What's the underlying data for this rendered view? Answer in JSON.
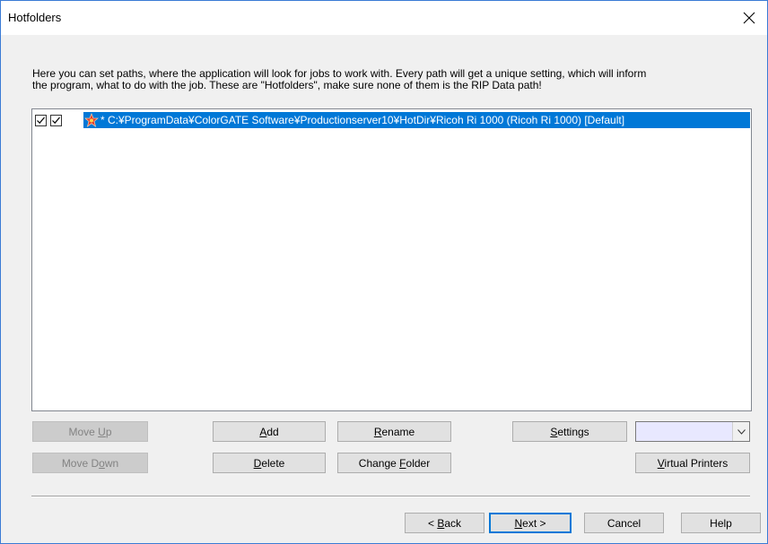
{
  "window": {
    "title": "Hotfolders",
    "close_icon": "close-icon"
  },
  "description": "Here you can set paths, where the application will look for jobs to work with. Every path will get a unique setting, which will inform\nthe program, what to do with the job. These are \"Hotfolders\", make sure none of them is the RIP Data path!",
  "hotfolders": [
    {
      "checked_1": true,
      "checked_2": true,
      "icon": "default-star-icon",
      "path": "* C:¥ProgramData¥ColorGATE Software¥Productionserver10¥HotDir¥Ricoh Ri 1000 (Ricoh Ri 1000) [Default]",
      "selected": true
    }
  ],
  "buttons": {
    "move_up": {
      "pre": "Move ",
      "key": "U",
      "post": "p"
    },
    "move_down": {
      "pre": "Move D",
      "key": "o",
      "post": "wn"
    },
    "add": {
      "pre": "",
      "key": "A",
      "post": "dd"
    },
    "delete": {
      "pre": "",
      "key": "D",
      "post": "elete"
    },
    "rename": {
      "pre": "",
      "key": "R",
      "post": "ename"
    },
    "change_folder": {
      "pre": "Change ",
      "key": "F",
      "post": "older"
    },
    "settings": {
      "pre": "",
      "key": "S",
      "post": "ettings"
    },
    "virtual_printers": {
      "pre": "",
      "key": "V",
      "post": "irtual Printers"
    },
    "back": {
      "pre": "< ",
      "key": "B",
      "post": "ack"
    },
    "next": {
      "pre": "",
      "key": "N",
      "post": "ext >"
    },
    "cancel": "Cancel",
    "help": "Help"
  },
  "combo": {
    "value": ""
  },
  "colors": {
    "selection": "#0078d7",
    "disabled_text": "#838383"
  }
}
